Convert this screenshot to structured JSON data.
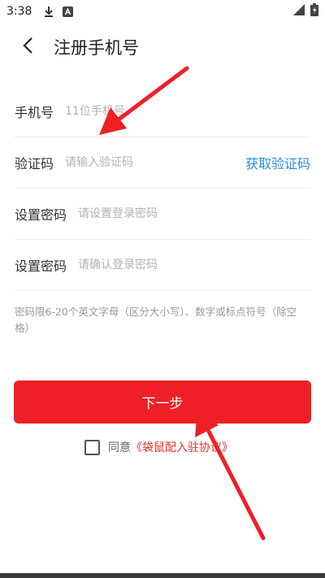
{
  "status_bar": {
    "time": "3:38",
    "icons": [
      "download-icon",
      "notification-a-icon",
      "signal-icon",
      "battery-icon"
    ]
  },
  "header": {
    "title": "注册手机号",
    "back_icon": "chevron-left-icon"
  },
  "form": {
    "phone": {
      "label": "手机号",
      "placeholder": "11位手机号"
    },
    "code": {
      "label": "验证码",
      "placeholder": "请输入验证码",
      "action": "获取验证码"
    },
    "password": {
      "label": "设置密码",
      "placeholder": "请设置登录密码"
    },
    "confirm": {
      "label": "设置密码",
      "placeholder": "请确认登录密码"
    },
    "hint": "密码限6-20个英文字母（区分大小写）、数字或标点符号（除空格）"
  },
  "next_button": {
    "label": "下一步"
  },
  "agreement": {
    "prefix": "同意",
    "link": "《袋鼠配入驻协议》",
    "checked": false
  },
  "colors": {
    "primary": "#ee2026",
    "link": "#2a8fdf",
    "agreement_link": "#e33030",
    "annotation_arrow": "#ee2026"
  }
}
